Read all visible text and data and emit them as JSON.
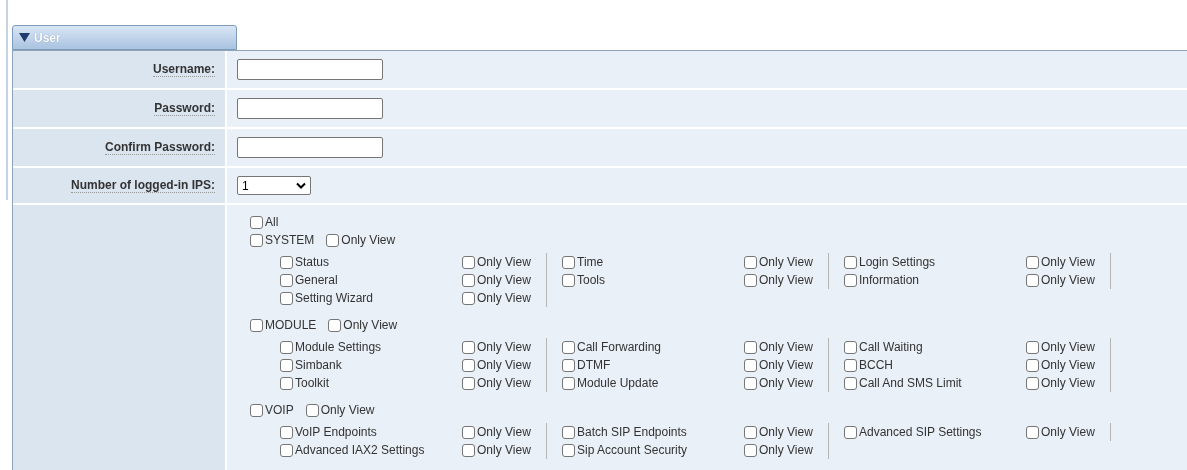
{
  "section": {
    "title": "User",
    "expanded": true
  },
  "fields": [
    {
      "label": "Username:",
      "kind": "text"
    },
    {
      "label": "Password:",
      "kind": "password"
    },
    {
      "label": "Confirm Password:",
      "kind": "password"
    },
    {
      "label": "Number of logged-in IPS:",
      "kind": "select",
      "value": "1"
    }
  ],
  "permissions": {
    "all": {
      "label": "All",
      "checked": false
    },
    "groups": [
      {
        "label": "SYSTEM",
        "checked": false,
        "only_view": {
          "label": "Only View",
          "checked": false
        },
        "columns": [
          [
            {
              "label": "Status",
              "checked": false,
              "only_view": {
                "label": "Only View",
                "checked": false
              }
            },
            {
              "label": "General",
              "checked": false,
              "only_view": {
                "label": "Only View",
                "checked": false
              }
            },
            {
              "label": "Setting Wizard",
              "checked": false,
              "only_view": {
                "label": "Only View",
                "checked": false
              }
            }
          ],
          [
            {
              "label": "Time",
              "checked": false,
              "only_view": {
                "label": "Only View",
                "checked": false
              }
            },
            {
              "label": "Tools",
              "checked": false,
              "only_view": {
                "label": "Only View",
                "checked": false
              }
            }
          ],
          [
            {
              "label": "Login Settings",
              "checked": false,
              "only_view": {
                "label": "Only View",
                "checked": false
              }
            },
            {
              "label": "Information",
              "checked": false,
              "only_view": {
                "label": "Only View",
                "checked": false
              }
            }
          ]
        ]
      },
      {
        "label": "MODULE",
        "checked": false,
        "only_view": {
          "label": "Only View",
          "checked": false
        },
        "columns": [
          [
            {
              "label": "Module Settings",
              "checked": false,
              "only_view": {
                "label": "Only View",
                "checked": false
              }
            },
            {
              "label": "Simbank",
              "checked": false,
              "only_view": {
                "label": "Only View",
                "checked": false
              }
            },
            {
              "label": "Toolkit",
              "checked": false,
              "only_view": {
                "label": "Only View",
                "checked": false
              }
            }
          ],
          [
            {
              "label": "Call Forwarding",
              "checked": false,
              "only_view": {
                "label": "Only View",
                "checked": false
              }
            },
            {
              "label": "DTMF",
              "checked": false,
              "only_view": {
                "label": "Only View",
                "checked": false
              }
            },
            {
              "label": "Module Update",
              "checked": false,
              "only_view": {
                "label": "Only View",
                "checked": false
              }
            }
          ],
          [
            {
              "label": "Call Waiting",
              "checked": false,
              "only_view": {
                "label": "Only View",
                "checked": false
              }
            },
            {
              "label": "BCCH",
              "checked": false,
              "only_view": {
                "label": "Only View",
                "checked": false
              }
            },
            {
              "label": "Call And SMS Limit",
              "checked": false,
              "only_view": {
                "label": "Only View",
                "checked": false
              }
            }
          ]
        ]
      },
      {
        "label": "VOIP",
        "checked": false,
        "only_view": {
          "label": "Only View",
          "checked": false
        },
        "columns": [
          [
            {
              "label": "VoIP Endpoints",
              "checked": false,
              "only_view": {
                "label": "Only View",
                "checked": false
              }
            },
            {
              "label": "Advanced IAX2 Settings",
              "checked": false,
              "only_view": {
                "label": "Only View",
                "checked": false
              }
            }
          ],
          [
            {
              "label": "Batch SIP Endpoints",
              "checked": false,
              "only_view": {
                "label": "Only View",
                "checked": false
              }
            },
            {
              "label": "Sip Account Security",
              "checked": false,
              "only_view": {
                "label": "Only View",
                "checked": false
              }
            }
          ],
          [
            {
              "label": "Advanced SIP Settings",
              "checked": false,
              "only_view": {
                "label": "Only View",
                "checked": false
              }
            }
          ]
        ]
      }
    ]
  }
}
